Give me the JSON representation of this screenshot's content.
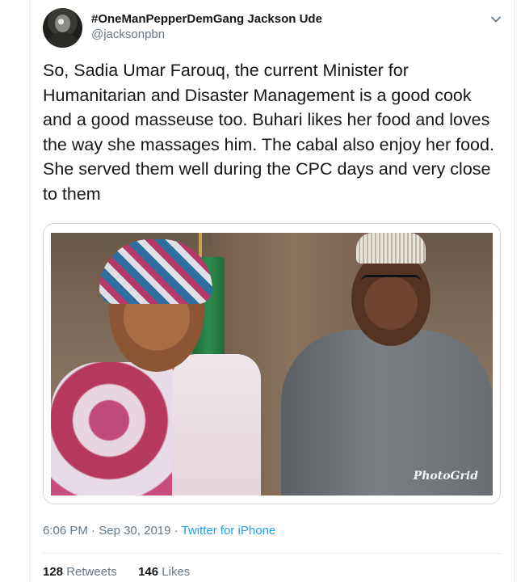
{
  "author": {
    "display_name": "#OneManPepperDemGang Jackson Ude",
    "handle": "@jacksonpbn"
  },
  "tweet": {
    "text": "So, Sadia Umar Farouq, the current Minister for Humanitarian and Disaster Management is a good cook and a good masseuse too. Buhari likes her food and loves the way she massages him. The cabal also enjoy her food. She served them well during the CPC days and very close to them"
  },
  "media": {
    "watermark": "PhotoGrid"
  },
  "meta": {
    "time": "6:06 PM",
    "separator": "·",
    "date": "Sep 30, 2019",
    "source": "Twitter for iPhone"
  },
  "stats": {
    "retweets_count": "128",
    "retweets_label": "Retweets",
    "likes_count": "146",
    "likes_label": "Likes"
  },
  "colors": {
    "link": "#1da1f2",
    "secondary_text": "#657786",
    "primary_text": "#14171a",
    "border": "#e6ecf0"
  },
  "icons": {
    "menu": "chevron-down-icon"
  }
}
